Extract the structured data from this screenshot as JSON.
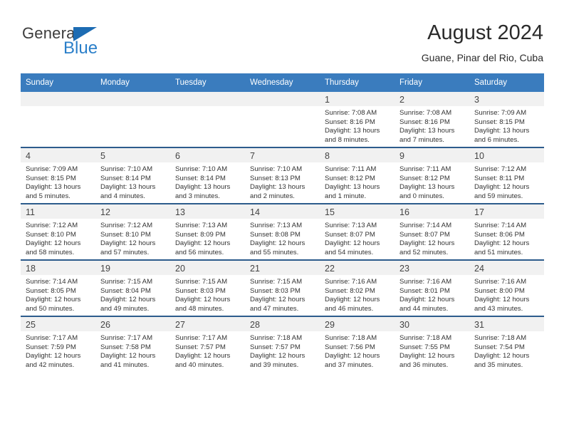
{
  "brand": {
    "name_top": "General",
    "name_bottom": "Blue",
    "triangle_color": "#1d6cb3",
    "blue_color": "#2a7fc9"
  },
  "header": {
    "title": "August 2024",
    "subtitle": "Guane, Pinar del Rio, Cuba"
  },
  "theme": {
    "header_row_bg": "#3a7cbe",
    "row_divider": "#2d5c8c",
    "daynum_strip_bg": "#f1f1f1"
  },
  "weekday_headers": [
    "Sunday",
    "Monday",
    "Tuesday",
    "Wednesday",
    "Thursday",
    "Friday",
    "Saturday"
  ],
  "weeks": [
    [
      {
        "day": "",
        "empty": true
      },
      {
        "day": "",
        "empty": true
      },
      {
        "day": "",
        "empty": true
      },
      {
        "day": "",
        "empty": true
      },
      {
        "day": "1",
        "sunrise": "Sunrise: 7:08 AM",
        "sunset": "Sunset: 8:16 PM",
        "daylight_1": "Daylight: 13 hours",
        "daylight_2": "and 8 minutes."
      },
      {
        "day": "2",
        "sunrise": "Sunrise: 7:08 AM",
        "sunset": "Sunset: 8:16 PM",
        "daylight_1": "Daylight: 13 hours",
        "daylight_2": "and 7 minutes."
      },
      {
        "day": "3",
        "sunrise": "Sunrise: 7:09 AM",
        "sunset": "Sunset: 8:15 PM",
        "daylight_1": "Daylight: 13 hours",
        "daylight_2": "and 6 minutes."
      }
    ],
    [
      {
        "day": "4",
        "sunrise": "Sunrise: 7:09 AM",
        "sunset": "Sunset: 8:15 PM",
        "daylight_1": "Daylight: 13 hours",
        "daylight_2": "and 5 minutes."
      },
      {
        "day": "5",
        "sunrise": "Sunrise: 7:10 AM",
        "sunset": "Sunset: 8:14 PM",
        "daylight_1": "Daylight: 13 hours",
        "daylight_2": "and 4 minutes."
      },
      {
        "day": "6",
        "sunrise": "Sunrise: 7:10 AM",
        "sunset": "Sunset: 8:14 PM",
        "daylight_1": "Daylight: 13 hours",
        "daylight_2": "and 3 minutes."
      },
      {
        "day": "7",
        "sunrise": "Sunrise: 7:10 AM",
        "sunset": "Sunset: 8:13 PM",
        "daylight_1": "Daylight: 13 hours",
        "daylight_2": "and 2 minutes."
      },
      {
        "day": "8",
        "sunrise": "Sunrise: 7:11 AM",
        "sunset": "Sunset: 8:12 PM",
        "daylight_1": "Daylight: 13 hours",
        "daylight_2": "and 1 minute."
      },
      {
        "day": "9",
        "sunrise": "Sunrise: 7:11 AM",
        "sunset": "Sunset: 8:12 PM",
        "daylight_1": "Daylight: 13 hours",
        "daylight_2": "and 0 minutes."
      },
      {
        "day": "10",
        "sunrise": "Sunrise: 7:12 AM",
        "sunset": "Sunset: 8:11 PM",
        "daylight_1": "Daylight: 12 hours",
        "daylight_2": "and 59 minutes."
      }
    ],
    [
      {
        "day": "11",
        "sunrise": "Sunrise: 7:12 AM",
        "sunset": "Sunset: 8:10 PM",
        "daylight_1": "Daylight: 12 hours",
        "daylight_2": "and 58 minutes."
      },
      {
        "day": "12",
        "sunrise": "Sunrise: 7:12 AM",
        "sunset": "Sunset: 8:10 PM",
        "daylight_1": "Daylight: 12 hours",
        "daylight_2": "and 57 minutes."
      },
      {
        "day": "13",
        "sunrise": "Sunrise: 7:13 AM",
        "sunset": "Sunset: 8:09 PM",
        "daylight_1": "Daylight: 12 hours",
        "daylight_2": "and 56 minutes."
      },
      {
        "day": "14",
        "sunrise": "Sunrise: 7:13 AM",
        "sunset": "Sunset: 8:08 PM",
        "daylight_1": "Daylight: 12 hours",
        "daylight_2": "and 55 minutes."
      },
      {
        "day": "15",
        "sunrise": "Sunrise: 7:13 AM",
        "sunset": "Sunset: 8:07 PM",
        "daylight_1": "Daylight: 12 hours",
        "daylight_2": "and 54 minutes."
      },
      {
        "day": "16",
        "sunrise": "Sunrise: 7:14 AM",
        "sunset": "Sunset: 8:07 PM",
        "daylight_1": "Daylight: 12 hours",
        "daylight_2": "and 52 minutes."
      },
      {
        "day": "17",
        "sunrise": "Sunrise: 7:14 AM",
        "sunset": "Sunset: 8:06 PM",
        "daylight_1": "Daylight: 12 hours",
        "daylight_2": "and 51 minutes."
      }
    ],
    [
      {
        "day": "18",
        "sunrise": "Sunrise: 7:14 AM",
        "sunset": "Sunset: 8:05 PM",
        "daylight_1": "Daylight: 12 hours",
        "daylight_2": "and 50 minutes."
      },
      {
        "day": "19",
        "sunrise": "Sunrise: 7:15 AM",
        "sunset": "Sunset: 8:04 PM",
        "daylight_1": "Daylight: 12 hours",
        "daylight_2": "and 49 minutes."
      },
      {
        "day": "20",
        "sunrise": "Sunrise: 7:15 AM",
        "sunset": "Sunset: 8:03 PM",
        "daylight_1": "Daylight: 12 hours",
        "daylight_2": "and 48 minutes."
      },
      {
        "day": "21",
        "sunrise": "Sunrise: 7:15 AM",
        "sunset": "Sunset: 8:03 PM",
        "daylight_1": "Daylight: 12 hours",
        "daylight_2": "and 47 minutes."
      },
      {
        "day": "22",
        "sunrise": "Sunrise: 7:16 AM",
        "sunset": "Sunset: 8:02 PM",
        "daylight_1": "Daylight: 12 hours",
        "daylight_2": "and 46 minutes."
      },
      {
        "day": "23",
        "sunrise": "Sunrise: 7:16 AM",
        "sunset": "Sunset: 8:01 PM",
        "daylight_1": "Daylight: 12 hours",
        "daylight_2": "and 44 minutes."
      },
      {
        "day": "24",
        "sunrise": "Sunrise: 7:16 AM",
        "sunset": "Sunset: 8:00 PM",
        "daylight_1": "Daylight: 12 hours",
        "daylight_2": "and 43 minutes."
      }
    ],
    [
      {
        "day": "25",
        "sunrise": "Sunrise: 7:17 AM",
        "sunset": "Sunset: 7:59 PM",
        "daylight_1": "Daylight: 12 hours",
        "daylight_2": "and 42 minutes."
      },
      {
        "day": "26",
        "sunrise": "Sunrise: 7:17 AM",
        "sunset": "Sunset: 7:58 PM",
        "daylight_1": "Daylight: 12 hours",
        "daylight_2": "and 41 minutes."
      },
      {
        "day": "27",
        "sunrise": "Sunrise: 7:17 AM",
        "sunset": "Sunset: 7:57 PM",
        "daylight_1": "Daylight: 12 hours",
        "daylight_2": "and 40 minutes."
      },
      {
        "day": "28",
        "sunrise": "Sunrise: 7:18 AM",
        "sunset": "Sunset: 7:57 PM",
        "daylight_1": "Daylight: 12 hours",
        "daylight_2": "and 39 minutes."
      },
      {
        "day": "29",
        "sunrise": "Sunrise: 7:18 AM",
        "sunset": "Sunset: 7:56 PM",
        "daylight_1": "Daylight: 12 hours",
        "daylight_2": "and 37 minutes."
      },
      {
        "day": "30",
        "sunrise": "Sunrise: 7:18 AM",
        "sunset": "Sunset: 7:55 PM",
        "daylight_1": "Daylight: 12 hours",
        "daylight_2": "and 36 minutes."
      },
      {
        "day": "31",
        "sunrise": "Sunrise: 7:18 AM",
        "sunset": "Sunset: 7:54 PM",
        "daylight_1": "Daylight: 12 hours",
        "daylight_2": "and 35 minutes."
      }
    ]
  ]
}
